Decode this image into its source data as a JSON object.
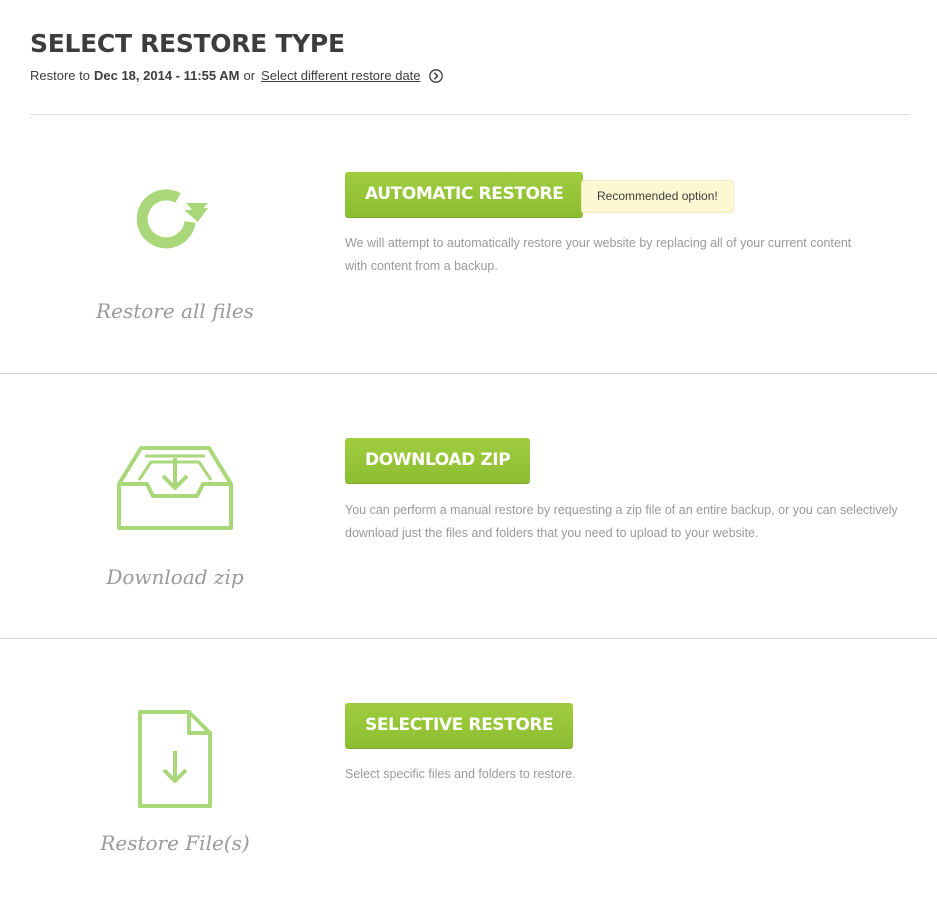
{
  "header": {
    "title": "SELECT RESTORE TYPE",
    "restore_to_prefix": "Restore to",
    "restore_date": "Dec 18, 2014 - 11:55 AM",
    "or_text": "or",
    "change_date_link": "Select different restore date"
  },
  "options": [
    {
      "icon": "restore-arrow-icon",
      "caption": "Restore all files",
      "button_label": "AUTOMATIC RESTORE",
      "badge": "Recommended option!",
      "description": "We will attempt to automatically restore your website by replacing all of your current content with content from a backup."
    },
    {
      "icon": "download-inbox-icon",
      "caption": "Download zip",
      "button_label": "DOWNLOAD ZIP",
      "description": "You can perform a manual restore by requesting a zip file of an entire backup, or you can selectively download just the files and folders that you need to upload to your website."
    },
    {
      "icon": "file-download-icon",
      "caption": "Restore File(s)",
      "button_label": "SELECTIVE RESTORE",
      "description": "Select specific files and folders to restore."
    }
  ],
  "colors": {
    "accent_green": "#97c63a",
    "icon_green": "#a9d779",
    "badge_bg": "#fdf7d2"
  }
}
